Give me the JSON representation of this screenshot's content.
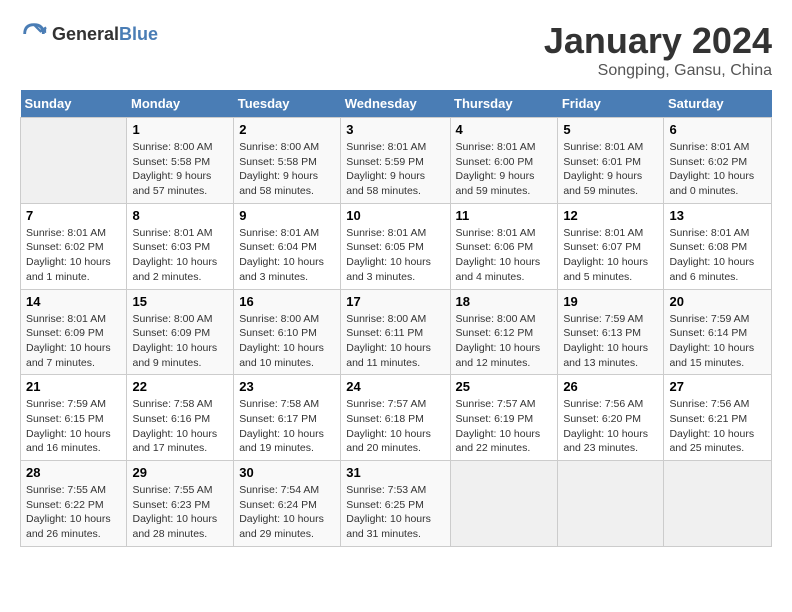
{
  "header": {
    "logo_general": "General",
    "logo_blue": "Blue",
    "month_title": "January 2024",
    "location": "Songping, Gansu, China"
  },
  "days_of_week": [
    "Sunday",
    "Monday",
    "Tuesday",
    "Wednesday",
    "Thursday",
    "Friday",
    "Saturday"
  ],
  "weeks": [
    [
      {
        "day": "",
        "info": ""
      },
      {
        "day": "1",
        "info": "Sunrise: 8:00 AM\nSunset: 5:58 PM\nDaylight: 9 hours\nand 57 minutes."
      },
      {
        "day": "2",
        "info": "Sunrise: 8:00 AM\nSunset: 5:58 PM\nDaylight: 9 hours\nand 58 minutes."
      },
      {
        "day": "3",
        "info": "Sunrise: 8:01 AM\nSunset: 5:59 PM\nDaylight: 9 hours\nand 58 minutes."
      },
      {
        "day": "4",
        "info": "Sunrise: 8:01 AM\nSunset: 6:00 PM\nDaylight: 9 hours\nand 59 minutes."
      },
      {
        "day": "5",
        "info": "Sunrise: 8:01 AM\nSunset: 6:01 PM\nDaylight: 9 hours\nand 59 minutes."
      },
      {
        "day": "6",
        "info": "Sunrise: 8:01 AM\nSunset: 6:02 PM\nDaylight: 10 hours\nand 0 minutes."
      }
    ],
    [
      {
        "day": "7",
        "info": "Sunrise: 8:01 AM\nSunset: 6:02 PM\nDaylight: 10 hours\nand 1 minute."
      },
      {
        "day": "8",
        "info": "Sunrise: 8:01 AM\nSunset: 6:03 PM\nDaylight: 10 hours\nand 2 minutes."
      },
      {
        "day": "9",
        "info": "Sunrise: 8:01 AM\nSunset: 6:04 PM\nDaylight: 10 hours\nand 3 minutes."
      },
      {
        "day": "10",
        "info": "Sunrise: 8:01 AM\nSunset: 6:05 PM\nDaylight: 10 hours\nand 3 minutes."
      },
      {
        "day": "11",
        "info": "Sunrise: 8:01 AM\nSunset: 6:06 PM\nDaylight: 10 hours\nand 4 minutes."
      },
      {
        "day": "12",
        "info": "Sunrise: 8:01 AM\nSunset: 6:07 PM\nDaylight: 10 hours\nand 5 minutes."
      },
      {
        "day": "13",
        "info": "Sunrise: 8:01 AM\nSunset: 6:08 PM\nDaylight: 10 hours\nand 6 minutes."
      }
    ],
    [
      {
        "day": "14",
        "info": "Sunrise: 8:01 AM\nSunset: 6:09 PM\nDaylight: 10 hours\nand 7 minutes."
      },
      {
        "day": "15",
        "info": "Sunrise: 8:00 AM\nSunset: 6:09 PM\nDaylight: 10 hours\nand 9 minutes."
      },
      {
        "day": "16",
        "info": "Sunrise: 8:00 AM\nSunset: 6:10 PM\nDaylight: 10 hours\nand 10 minutes."
      },
      {
        "day": "17",
        "info": "Sunrise: 8:00 AM\nSunset: 6:11 PM\nDaylight: 10 hours\nand 11 minutes."
      },
      {
        "day": "18",
        "info": "Sunrise: 8:00 AM\nSunset: 6:12 PM\nDaylight: 10 hours\nand 12 minutes."
      },
      {
        "day": "19",
        "info": "Sunrise: 7:59 AM\nSunset: 6:13 PM\nDaylight: 10 hours\nand 13 minutes."
      },
      {
        "day": "20",
        "info": "Sunrise: 7:59 AM\nSunset: 6:14 PM\nDaylight: 10 hours\nand 15 minutes."
      }
    ],
    [
      {
        "day": "21",
        "info": "Sunrise: 7:59 AM\nSunset: 6:15 PM\nDaylight: 10 hours\nand 16 minutes."
      },
      {
        "day": "22",
        "info": "Sunrise: 7:58 AM\nSunset: 6:16 PM\nDaylight: 10 hours\nand 17 minutes."
      },
      {
        "day": "23",
        "info": "Sunrise: 7:58 AM\nSunset: 6:17 PM\nDaylight: 10 hours\nand 19 minutes."
      },
      {
        "day": "24",
        "info": "Sunrise: 7:57 AM\nSunset: 6:18 PM\nDaylight: 10 hours\nand 20 minutes."
      },
      {
        "day": "25",
        "info": "Sunrise: 7:57 AM\nSunset: 6:19 PM\nDaylight: 10 hours\nand 22 minutes."
      },
      {
        "day": "26",
        "info": "Sunrise: 7:56 AM\nSunset: 6:20 PM\nDaylight: 10 hours\nand 23 minutes."
      },
      {
        "day": "27",
        "info": "Sunrise: 7:56 AM\nSunset: 6:21 PM\nDaylight: 10 hours\nand 25 minutes."
      }
    ],
    [
      {
        "day": "28",
        "info": "Sunrise: 7:55 AM\nSunset: 6:22 PM\nDaylight: 10 hours\nand 26 minutes."
      },
      {
        "day": "29",
        "info": "Sunrise: 7:55 AM\nSunset: 6:23 PM\nDaylight: 10 hours\nand 28 minutes."
      },
      {
        "day": "30",
        "info": "Sunrise: 7:54 AM\nSunset: 6:24 PM\nDaylight: 10 hours\nand 29 minutes."
      },
      {
        "day": "31",
        "info": "Sunrise: 7:53 AM\nSunset: 6:25 PM\nDaylight: 10 hours\nand 31 minutes."
      },
      {
        "day": "",
        "info": ""
      },
      {
        "day": "",
        "info": ""
      },
      {
        "day": "",
        "info": ""
      }
    ]
  ]
}
